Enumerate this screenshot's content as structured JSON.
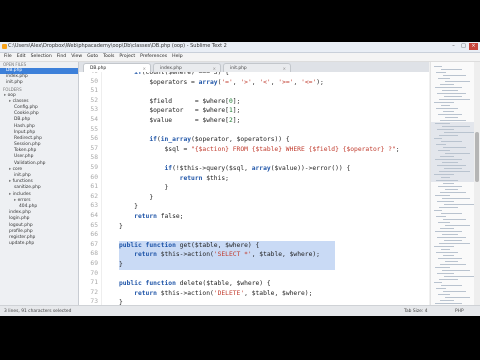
{
  "window": {
    "title": "C:\\Users\\Alex\\Dropbox\\Web\\phpacademy\\oop\\Db\\classes\\DB.php (oop) - Sublime Text 2",
    "controls": [
      "–",
      "□",
      "×"
    ]
  },
  "menu": [
    "File",
    "Edit",
    "Selection",
    "Find",
    "View",
    "Goto",
    "Tools",
    "Project",
    "Preferences",
    "Help"
  ],
  "sidebar": {
    "open_files_header": "OPEN FILES",
    "open_files": [
      "DB.php",
      "index.php",
      "init.php"
    ],
    "folders_header": "FOLDERS",
    "tree": [
      {
        "label": "oop",
        "folder": true,
        "indent": 0
      },
      {
        "label": "classes",
        "folder": true,
        "indent": 1
      },
      {
        "label": "Config.php",
        "indent": 2
      },
      {
        "label": "Cookie.php",
        "indent": 2
      },
      {
        "label": "DB.php",
        "indent": 2,
        "active": true
      },
      {
        "label": "Hash.php",
        "indent": 2
      },
      {
        "label": "Input.php",
        "indent": 2
      },
      {
        "label": "Redirect.php",
        "indent": 2
      },
      {
        "label": "Session.php",
        "indent": 2
      },
      {
        "label": "Token.php",
        "indent": 2
      },
      {
        "label": "User.php",
        "indent": 2
      },
      {
        "label": "Validation.php",
        "indent": 2
      },
      {
        "label": "core",
        "folder": true,
        "indent": 1
      },
      {
        "label": "init.php",
        "indent": 2
      },
      {
        "label": "functions",
        "folder": true,
        "indent": 1
      },
      {
        "label": "sanitize.php",
        "indent": 2
      },
      {
        "label": "includes",
        "folder": true,
        "indent": 1
      },
      {
        "label": "errors",
        "folder": true,
        "indent": 2
      },
      {
        "label": "404.php",
        "indent": 3
      },
      {
        "label": "index.php",
        "indent": 1
      },
      {
        "label": "login.php",
        "indent": 1
      },
      {
        "label": "logout.php",
        "indent": 1
      },
      {
        "label": "profile.php",
        "indent": 1
      },
      {
        "label": "register.php",
        "indent": 1
      },
      {
        "label": "update.php",
        "indent": 1
      }
    ]
  },
  "tabs": [
    {
      "label": "DB.php",
      "active": true
    },
    {
      "label": "index.php",
      "active": false
    },
    {
      "label": "init.php",
      "active": false
    }
  ],
  "editor": {
    "lines": [
      {
        "n": "49",
        "parts": [
          [
            "t",
            "    "
          ],
          [
            "p",
            "if"
          ],
          [
            "t",
            "(count($where) === 3) {"
          ]
        ]
      },
      {
        "n": "50",
        "parts": [
          [
            "t",
            "        $operators = "
          ],
          [
            "p",
            "array"
          ],
          [
            "t",
            "("
          ],
          [
            "s",
            "'='"
          ],
          [
            "t",
            ", "
          ],
          [
            "s",
            "'>'"
          ],
          [
            "t",
            ", "
          ],
          [
            "s",
            "'<'"
          ],
          [
            "t",
            ", "
          ],
          [
            "s",
            "'>='"
          ],
          [
            "t",
            ", "
          ],
          [
            "s",
            "'<='"
          ],
          [
            "t",
            ");"
          ]
        ]
      },
      {
        "n": "51",
        "parts": [
          [
            "t",
            ""
          ]
        ]
      },
      {
        "n": "52",
        "parts": [
          [
            "t",
            "        $field      = $where["
          ],
          [
            "d",
            "0"
          ],
          [
            "t",
            "];"
          ]
        ]
      },
      {
        "n": "53",
        "parts": [
          [
            "t",
            "        $operator   = $where["
          ],
          [
            "d",
            "1"
          ],
          [
            "t",
            "];"
          ]
        ]
      },
      {
        "n": "54",
        "parts": [
          [
            "t",
            "        $value      = $where["
          ],
          [
            "d",
            "2"
          ],
          [
            "t",
            "];"
          ]
        ]
      },
      {
        "n": "55",
        "parts": [
          [
            "t",
            ""
          ]
        ]
      },
      {
        "n": "56",
        "parts": [
          [
            "t",
            "        "
          ],
          [
            "p",
            "if"
          ],
          [
            "t",
            "("
          ],
          [
            "p",
            "in_array"
          ],
          [
            "t",
            "($operator, $operators)) {"
          ]
        ]
      },
      {
        "n": "57",
        "parts": [
          [
            "t",
            "            $sql = "
          ],
          [
            "s",
            "\"{$action} FROM {$table} WHERE {$field} {$operator} ?\""
          ],
          [
            "t",
            ";"
          ]
        ]
      },
      {
        "n": "58",
        "parts": [
          [
            "t",
            ""
          ]
        ]
      },
      {
        "n": "59",
        "parts": [
          [
            "t",
            "            "
          ],
          [
            "p",
            "if"
          ],
          [
            "t",
            "(!$this->query($sql, "
          ],
          [
            "p",
            "array"
          ],
          [
            "t",
            "($value))->error()) {"
          ]
        ]
      },
      {
        "n": "60",
        "parts": [
          [
            "t",
            "                "
          ],
          [
            "p",
            "return"
          ],
          [
            "t",
            " $this;"
          ]
        ]
      },
      {
        "n": "61",
        "parts": [
          [
            "t",
            "            }"
          ]
        ]
      },
      {
        "n": "62",
        "parts": [
          [
            "t",
            "        }"
          ]
        ]
      },
      {
        "n": "63",
        "parts": [
          [
            "t",
            "    }"
          ]
        ]
      },
      {
        "n": "64",
        "parts": [
          [
            "t",
            "    "
          ],
          [
            "p",
            "return"
          ],
          [
            "t",
            " false;"
          ]
        ]
      },
      {
        "n": "65",
        "parts": [
          [
            "t",
            "}"
          ]
        ]
      },
      {
        "n": "66",
        "parts": [
          [
            "t",
            ""
          ]
        ]
      },
      {
        "n": "67",
        "sel": true,
        "parts": [
          [
            "p",
            "public function"
          ],
          [
            "t",
            " get($table, $where) {"
          ]
        ]
      },
      {
        "n": "68",
        "sel": true,
        "parts": [
          [
            "t",
            "    "
          ],
          [
            "p",
            "return"
          ],
          [
            "t",
            " $this->action("
          ],
          [
            "s",
            "'SELECT *'"
          ],
          [
            "t",
            ", $table, $where);"
          ]
        ]
      },
      {
        "n": "69",
        "sel": true,
        "parts": [
          [
            "t",
            "}"
          ]
        ]
      },
      {
        "n": "70",
        "parts": [
          [
            "t",
            ""
          ]
        ]
      },
      {
        "n": "71",
        "parts": [
          [
            "p",
            "public function"
          ],
          [
            "t",
            " delete($table, $where) {"
          ]
        ]
      },
      {
        "n": "72",
        "parts": [
          [
            "t",
            "    "
          ],
          [
            "p",
            "return"
          ],
          [
            "t",
            " $this->action("
          ],
          [
            "s",
            "'DELETE'"
          ],
          [
            "t",
            ", $table, $where);"
          ]
        ]
      },
      {
        "n": "73",
        "parts": [
          [
            "t",
            "}"
          ]
        ]
      },
      {
        "n": "74",
        "parts": [
          [
            "t",
            ""
          ]
        ]
      },
      {
        "n": "75",
        "parts": [
          [
            "p",
            "public function"
          ],
          [
            "t",
            " results() {"
          ]
        ]
      },
      {
        "n": "76",
        "parts": [
          [
            "t",
            "    "
          ],
          [
            "p",
            "return"
          ],
          [
            "t",
            " $this->_results;"
          ]
        ]
      },
      {
        "n": "77",
        "parts": [
          [
            "t",
            "}"
          ]
        ]
      }
    ]
  },
  "status": {
    "left": "3 lines, 91 characters selected",
    "tab_size": "Tab Size: 4",
    "syntax": "PHP"
  },
  "colors": {
    "keyword": "#1f55a8",
    "string": "#c0392b",
    "number": "#1a7a2e",
    "selection": "#c9daf5",
    "active_sidebar": "#3d80d9"
  }
}
